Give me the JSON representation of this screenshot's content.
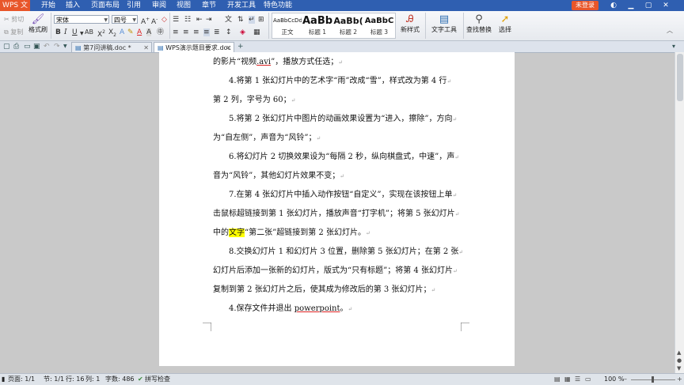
{
  "app": {
    "name": "WPS 文字",
    "menus": [
      "开始",
      "插入",
      "页面布局",
      "引用",
      "审阅",
      "视图",
      "章节",
      "开发工具",
      "特色功能"
    ],
    "login": "未登录"
  },
  "ribbon": {
    "cut": "剪切",
    "copy": "复制",
    "format_painter": "格式刷",
    "font": "宋体",
    "size": "四号",
    "styles": [
      {
        "sample": "AaBbCcDd",
        "label": "正文"
      },
      {
        "sample": "AaBb",
        "label": "标题 1"
      },
      {
        "sample": "AaBb(",
        "label": "标题 2"
      },
      {
        "sample": "AaBbC",
        "label": "标题 3"
      }
    ],
    "new_style": "新样式",
    "text_tools": "文字工具",
    "find_replace": "查找替换",
    "select": "选择"
  },
  "tabs": [
    {
      "label": "第7问讲稿.doc *",
      "active": false
    },
    {
      "label": "WPS演示题目要求.doc",
      "active": true
    }
  ],
  "document": {
    "paragraphs": [
      {
        "parts": [
          {
            "t": "的影片“视频"
          },
          {
            "t": ".avi",
            "ul": true
          },
          {
            "t": "”，播放方式任选；"
          }
        ]
      },
      {
        "parts": [
          {
            "t": "4.将第 1 张幻灯片中的艺术字“雨”改成“雪”，样式改为第 4 行"
          }
        ]
      },
      {
        "parts": [
          {
            "t": "第 2 列，字号为 60；"
          }
        ]
      },
      {
        "parts": [
          {
            "t": "5.将第 2 张幻灯片中图片的动画效果设置为“进入，擦除”，方向"
          }
        ]
      },
      {
        "parts": [
          {
            "t": "为“自左侧”，声音为“风铃”；"
          }
        ]
      },
      {
        "parts": [
          {
            "t": "6.将幻灯片 2 切换效果设为“每隔 2 秒，纵向棋盘式，中速”，声"
          }
        ]
      },
      {
        "parts": [
          {
            "t": "音为“风铃”，其他幻灯片效果不变；"
          }
        ]
      },
      {
        "parts": [
          {
            "t": "7.在第 4 张幻灯片中插入动作按钮“自定义”，实现在该按钮上单"
          }
        ]
      },
      {
        "parts": [
          {
            "t": "击鼠标超链接到第 1 张幻灯片，播放声音“打字机”；将第 5 张幻灯片"
          }
        ]
      },
      {
        "parts": [
          {
            "t": "中的"
          },
          {
            "t": "文字",
            "hl": true
          },
          {
            "t": "“第二张”超链接到第 2 张幻灯片。"
          }
        ]
      },
      {
        "parts": [
          {
            "t": "8.交换幻灯片 1 和幻灯片 3 位置，删除第 5 张幻灯片；在第 2 张"
          }
        ]
      },
      {
        "parts": [
          {
            "t": "幻灯片后添加一张新的幻灯片，版式为“只有标题”；将第 4 张幻灯片"
          }
        ]
      },
      {
        "parts": [
          {
            "t": "复制到第 2 张幻灯片之后，使其成为修改后的第 3 张幻灯片；"
          }
        ]
      },
      {
        "parts": [
          {
            "t": "4.保存文件并退出 "
          },
          {
            "t": "powerpoint",
            "ul": true
          },
          {
            "t": "。"
          }
        ]
      }
    ]
  },
  "status": {
    "page": "页面: 1/1",
    "section": "节: 1/1",
    "row": "行: 16",
    "col": "列: 1",
    "words": "字数: 486",
    "spell": "拼写检查",
    "zoom": "100 %"
  }
}
